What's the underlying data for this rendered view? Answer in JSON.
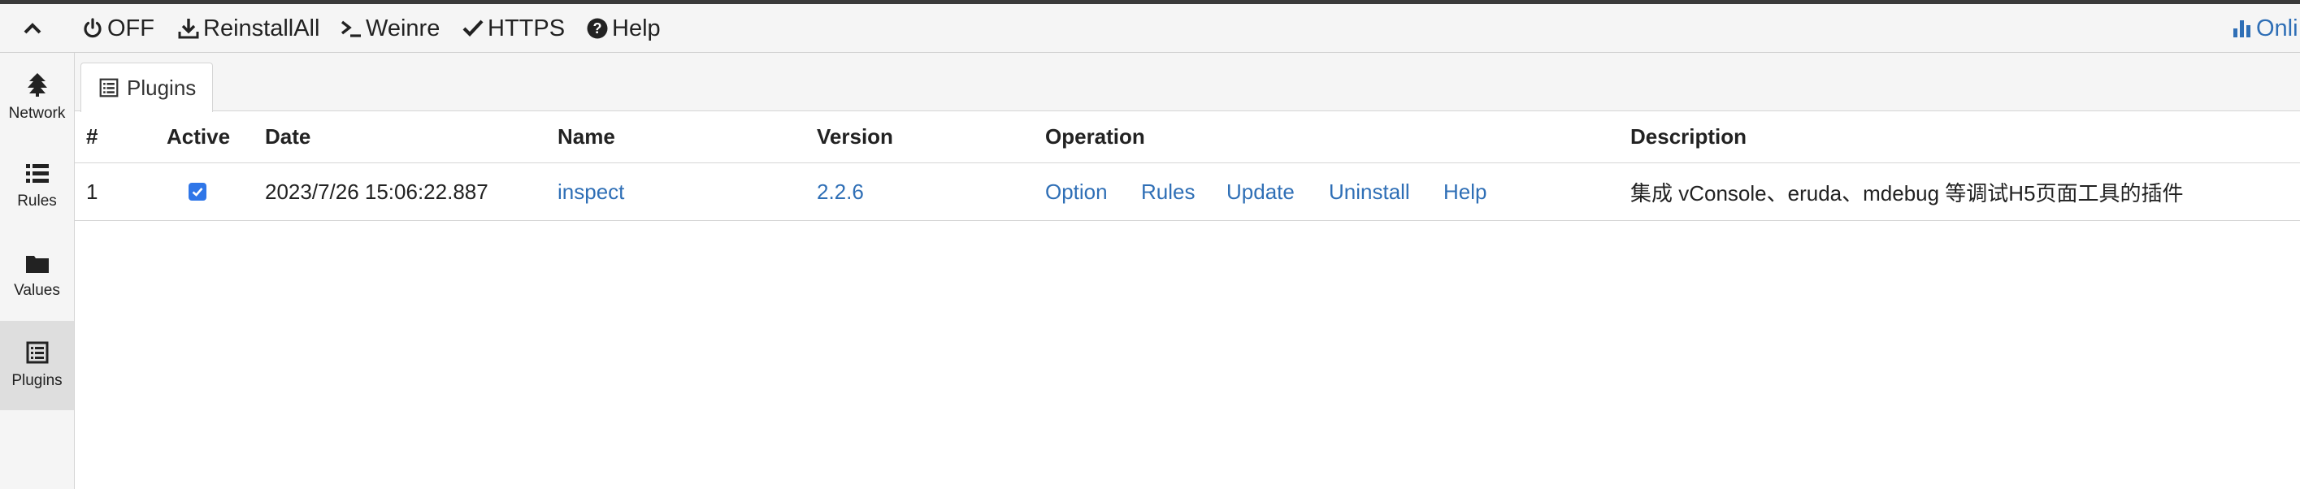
{
  "toolbar": {
    "toggle": "OFF",
    "reinstall": "ReinstallAll",
    "weinre": "Weinre",
    "https": "HTTPS",
    "help": "Help",
    "online": "Onli"
  },
  "sidebar": {
    "items": [
      {
        "label": "Network"
      },
      {
        "label": "Rules"
      },
      {
        "label": "Values"
      },
      {
        "label": "Plugins"
      }
    ]
  },
  "tabs": [
    {
      "label": "Plugins"
    }
  ],
  "table": {
    "headers": {
      "index": "#",
      "active": "Active",
      "date": "Date",
      "name": "Name",
      "version": "Version",
      "operation": "Operation",
      "description": "Description"
    },
    "rows": [
      {
        "index": "1",
        "active": true,
        "date": "2023/7/26 15:06:22.887",
        "name": "inspect",
        "version": "2.2.6",
        "operations": [
          "Option",
          "Rules",
          "Update",
          "Uninstall",
          "Help"
        ],
        "description": "集成 vConsole、eruda、mdebug 等调试H5页面工具的插件"
      }
    ]
  },
  "colors": {
    "link": "#2f6fb6",
    "checkbox": "#2f76e8",
    "toolbar_bg": "#f5f5f5",
    "sidebar_active_bg": "#dedede"
  }
}
